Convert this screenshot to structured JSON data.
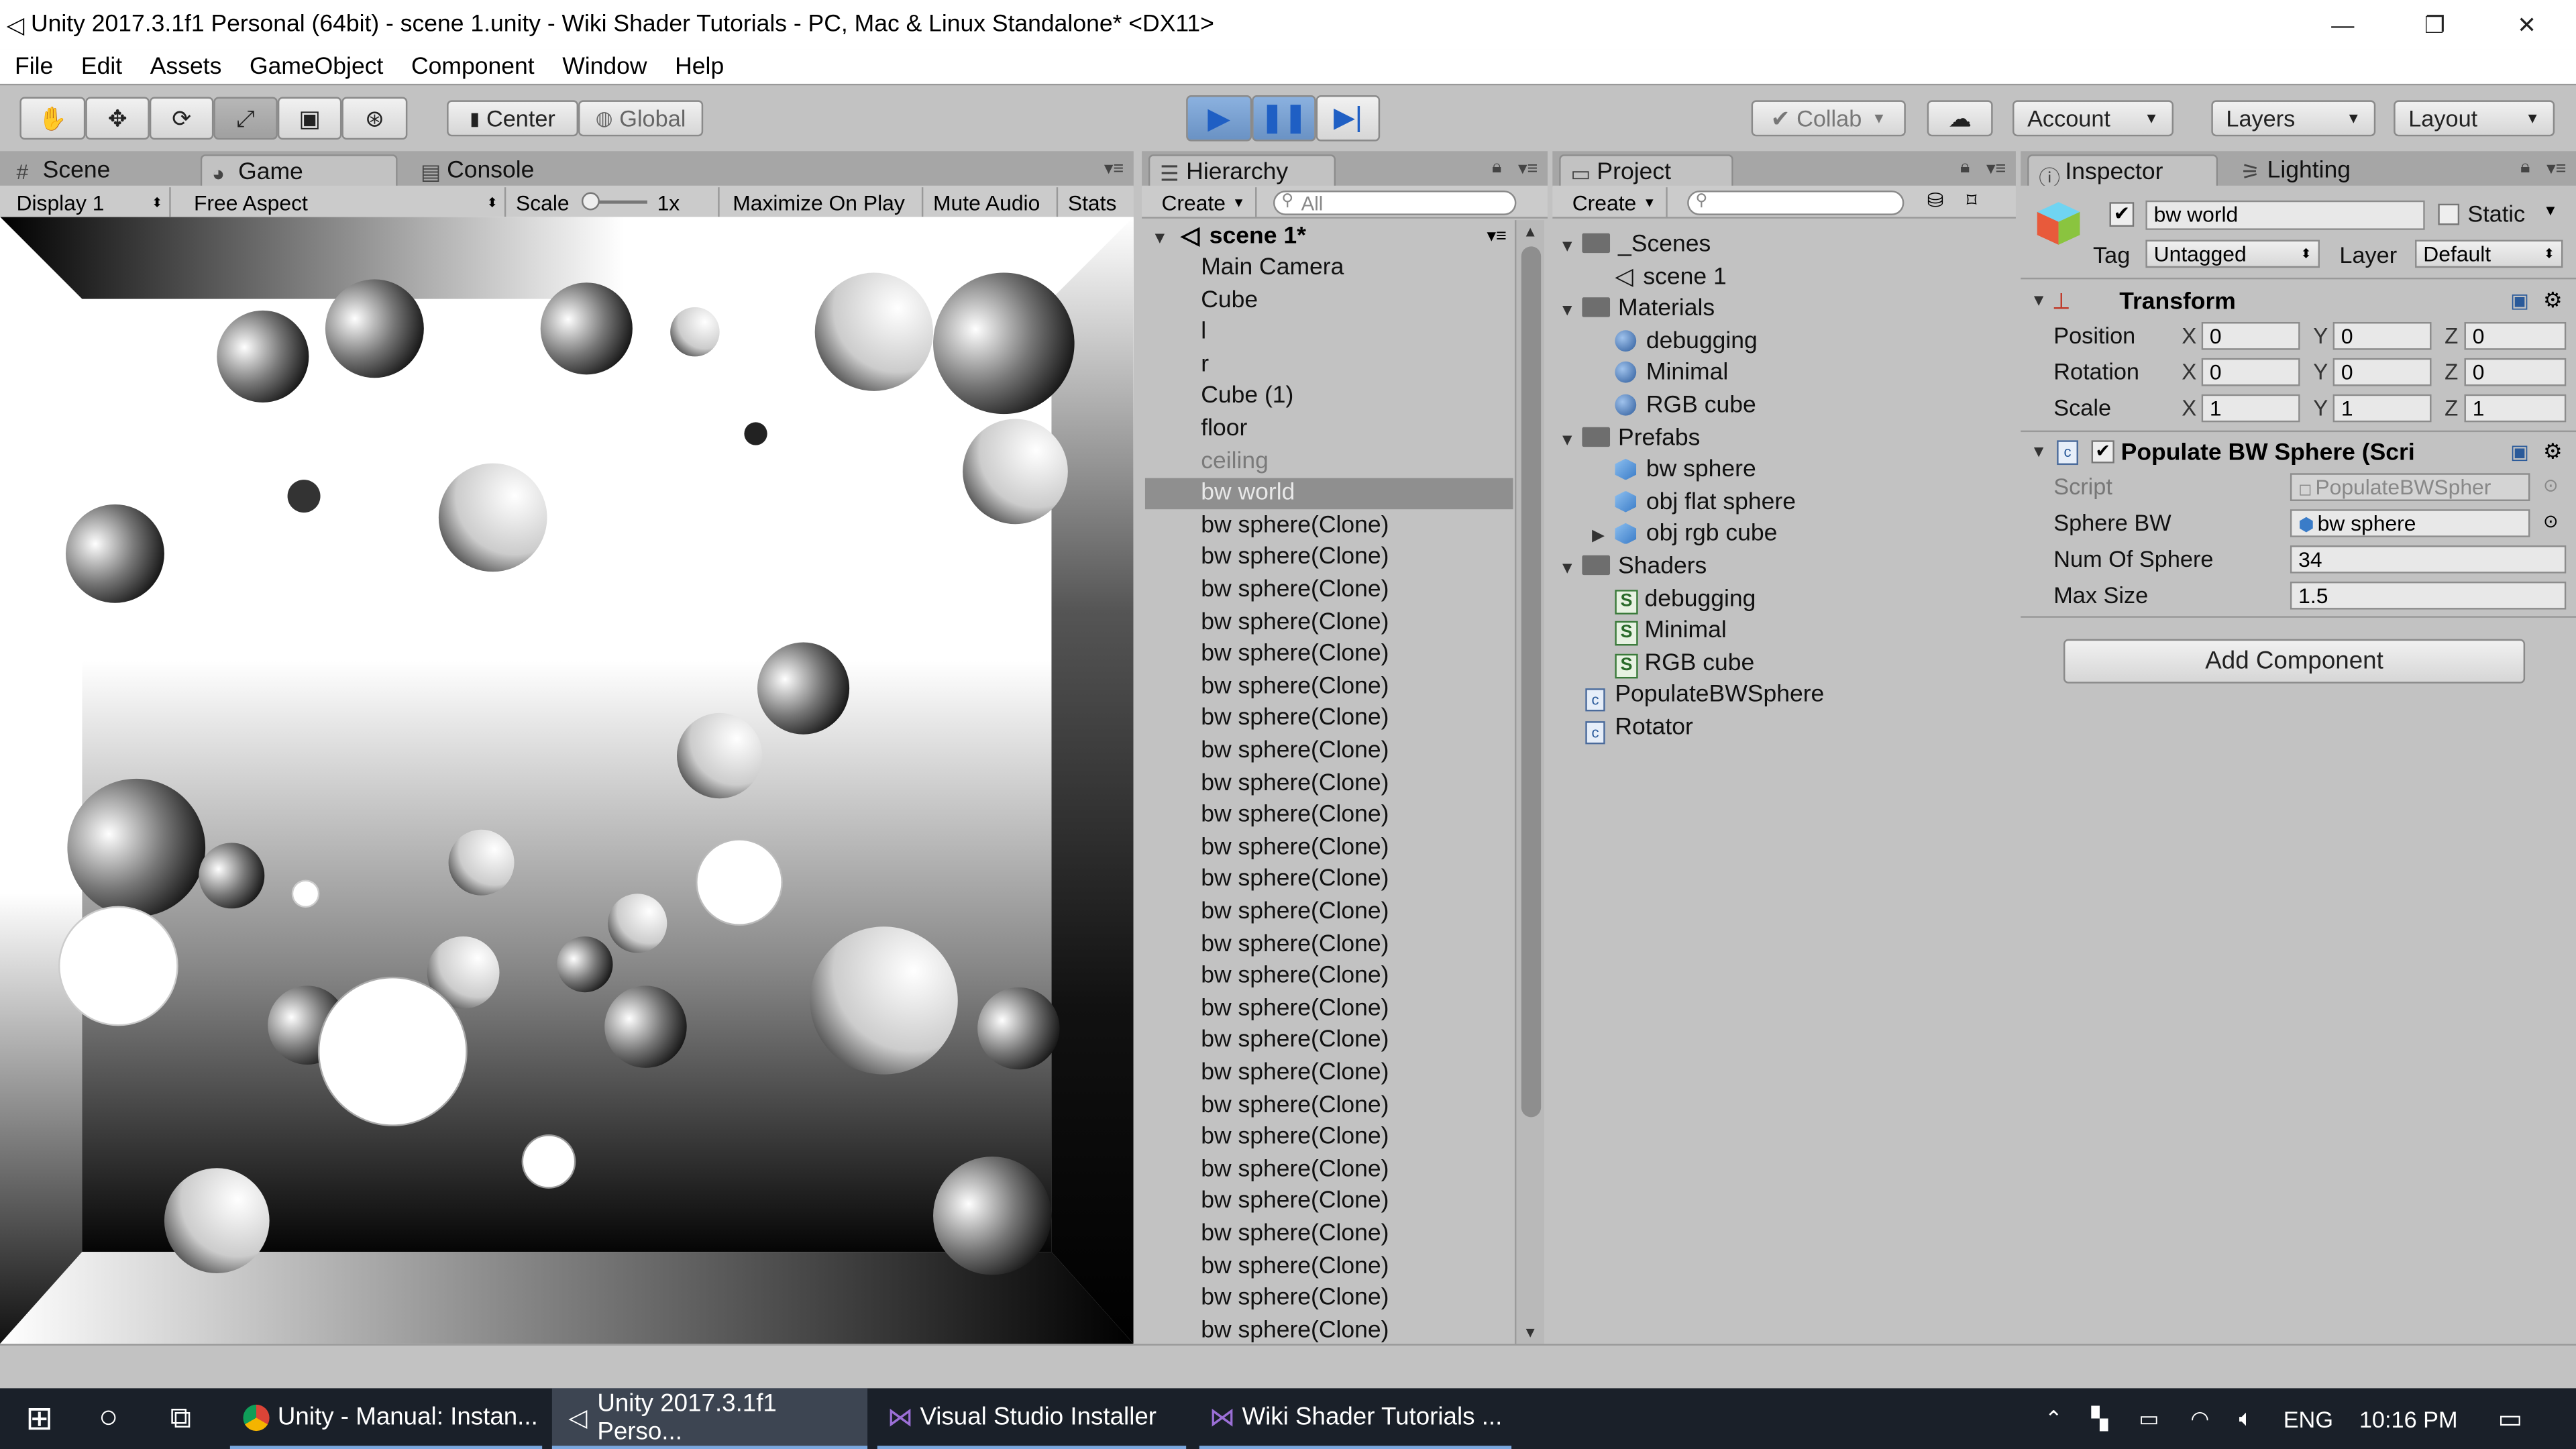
{
  "window": {
    "title": "Unity 2017.3.1f1 Personal (64bit) - scene 1.unity - Wiki Shader Tutorials - PC, Mac & Linux Standalone* <DX11>"
  },
  "menu": [
    "File",
    "Edit",
    "Assets",
    "GameObject",
    "Component",
    "Window",
    "Help"
  ],
  "toolbar": {
    "pivot": "Center",
    "space": "Global",
    "collab": "Collab",
    "account": "Account",
    "layers": "Layers",
    "layout": "Layout"
  },
  "game_panel": {
    "tabs": [
      "Scene",
      "Game",
      "Console"
    ],
    "display": "Display 1",
    "aspect": "Free Aspect",
    "scale_label": "Scale",
    "scale_value": "1x",
    "maximize": "Maximize On Play",
    "mute": "Mute Audio",
    "stats": "Stats"
  },
  "hierarchy": {
    "tab": "Hierarchy",
    "create": "Create",
    "search_placeholder": "All",
    "scene": "scene 1*",
    "items": [
      "Main Camera",
      "Cube",
      "l",
      "r",
      "Cube (1)",
      "floor",
      "ceiling",
      "bw world",
      "bw sphere(Clone)",
      "bw sphere(Clone)",
      "bw sphere(Clone)",
      "bw sphere(Clone)",
      "bw sphere(Clone)",
      "bw sphere(Clone)",
      "bw sphere(Clone)",
      "bw sphere(Clone)",
      "bw sphere(Clone)",
      "bw sphere(Clone)",
      "bw sphere(Clone)",
      "bw sphere(Clone)",
      "bw sphere(Clone)",
      "bw sphere(Clone)",
      "bw sphere(Clone)",
      "bw sphere(Clone)",
      "bw sphere(Clone)",
      "bw sphere(Clone)",
      "bw sphere(Clone)",
      "bw sphere(Clone)",
      "bw sphere(Clone)",
      "bw sphere(Clone)",
      "bw sphere(Clone)",
      "bw sphere(Clone)",
      "bw sphere(Clone)",
      "bw sphere(Clone)"
    ],
    "selected": "bw world",
    "disabled": "ceiling"
  },
  "project": {
    "tab": "Project",
    "create": "Create",
    "tree": [
      {
        "label": "_Scenes",
        "type": "folder"
      },
      {
        "label": "scene 1",
        "type": "scene"
      },
      {
        "label": "Materials",
        "type": "folder"
      },
      {
        "label": "debugging",
        "type": "material"
      },
      {
        "label": "Minimal",
        "type": "material"
      },
      {
        "label": "RGB cube",
        "type": "material"
      },
      {
        "label": "Prefabs",
        "type": "folder"
      },
      {
        "label": "bw sphere",
        "type": "prefab"
      },
      {
        "label": "obj flat sphere",
        "type": "prefab"
      },
      {
        "label": "obj rgb cube",
        "type": "prefab"
      },
      {
        "label": "Shaders",
        "type": "folder"
      },
      {
        "label": "debugging",
        "type": "shader"
      },
      {
        "label": "Minimal",
        "type": "shader"
      },
      {
        "label": "RGB cube",
        "type": "shader"
      },
      {
        "label": "PopulateBWSphere",
        "type": "script"
      },
      {
        "label": "Rotator",
        "type": "script"
      }
    ]
  },
  "inspector": {
    "tabs": [
      "Inspector",
      "Lighting"
    ],
    "object_name": "bw world",
    "static_label": "Static",
    "tag_label": "Tag",
    "tag_value": "Untagged",
    "layer_label": "Layer",
    "layer_value": "Default",
    "transform": {
      "title": "Transform",
      "position_label": "Position",
      "position": [
        "0",
        "0",
        "0"
      ],
      "rotation_label": "Rotation",
      "rotation": [
        "0",
        "0",
        "0"
      ],
      "scale_label": "Scale",
      "scale": [
        "1",
        "1",
        "1"
      ]
    },
    "script_component": {
      "title": "Populate BW Sphere (Scri",
      "script_label": "Script",
      "script_value": "PopulateBWSpher",
      "sphere_label": "Sphere BW",
      "sphere_value": "bw sphere",
      "num_label": "Num Of Sphere",
      "num_value": "34",
      "max_label": "Max Size",
      "max_value": "1.5"
    },
    "add_component": "Add Component"
  },
  "taskbar": {
    "items": [
      "Unity - Manual: Instan...",
      "Unity 2017.3.1f1 Perso...",
      "Visual Studio Installer",
      "Wiki Shader Tutorials ..."
    ],
    "lang": "ENG",
    "time": "10:16 PM"
  },
  "colors": {
    "selection": "#8f8f8f",
    "play_blue": "#7aa2d6",
    "taskbar": "#1a2029"
  }
}
